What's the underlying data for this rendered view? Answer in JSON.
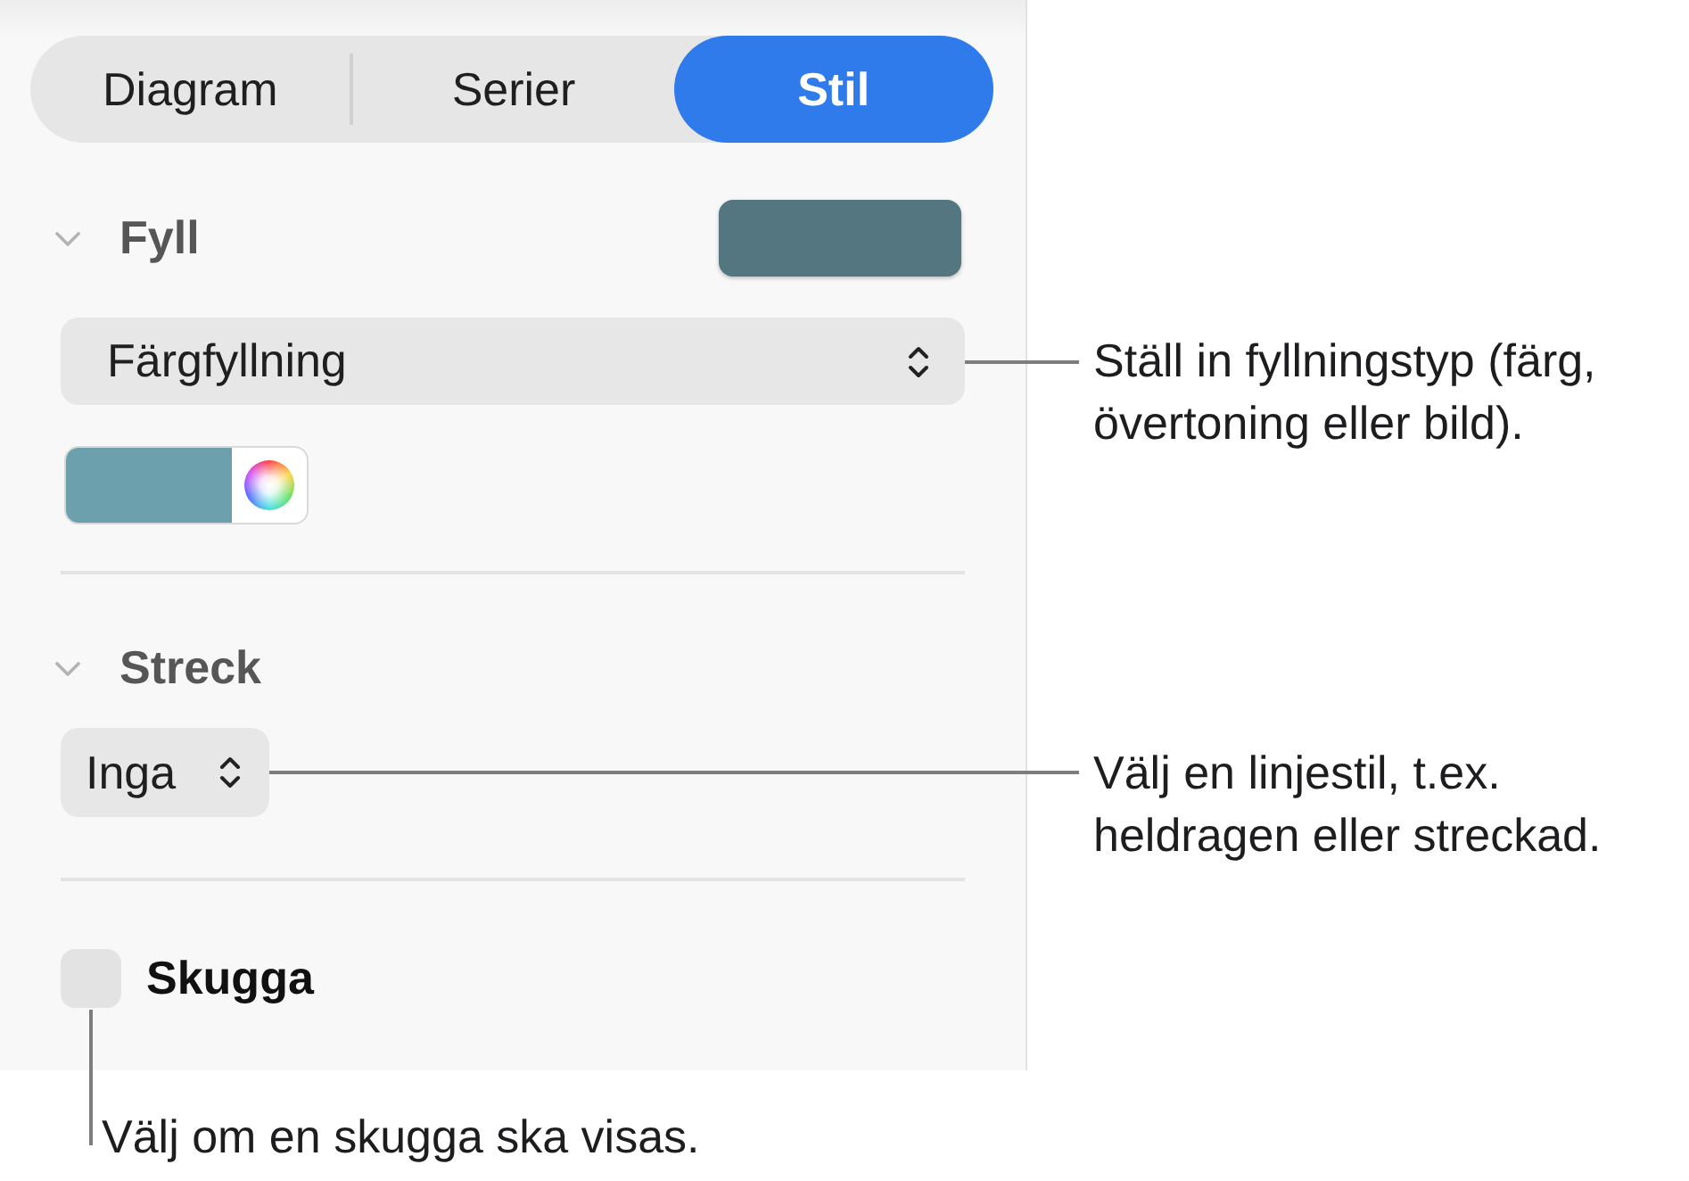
{
  "tabs": [
    {
      "label": "Diagram",
      "selected": false
    },
    {
      "label": "Serier",
      "selected": false
    },
    {
      "label": "Stil",
      "selected": true
    }
  ],
  "fill": {
    "title": "Fyll",
    "expanded": true,
    "color": "#537680",
    "fill_type": {
      "value": "Färgfyllning",
      "callout": {
        "kind": "side",
        "lines": [
          "Ställ in fyllningstyp (färg,",
          "övertoning eller bild)."
        ]
      }
    },
    "swatch": {
      "color": "#6ca0ad"
    }
  },
  "stroke": {
    "title": "Streck",
    "expanded": true,
    "style": {
      "value": "Inga",
      "callout": {
        "kind": "side",
        "lines": [
          "Välj en linjestil, t.ex.",
          "heldragen eller streckad."
        ]
      }
    }
  },
  "shadow": {
    "label": "Skugga",
    "checked": false,
    "callout": {
      "kind": "below",
      "lines": [
        "Välj om en skugga ska visas."
      ]
    }
  }
}
